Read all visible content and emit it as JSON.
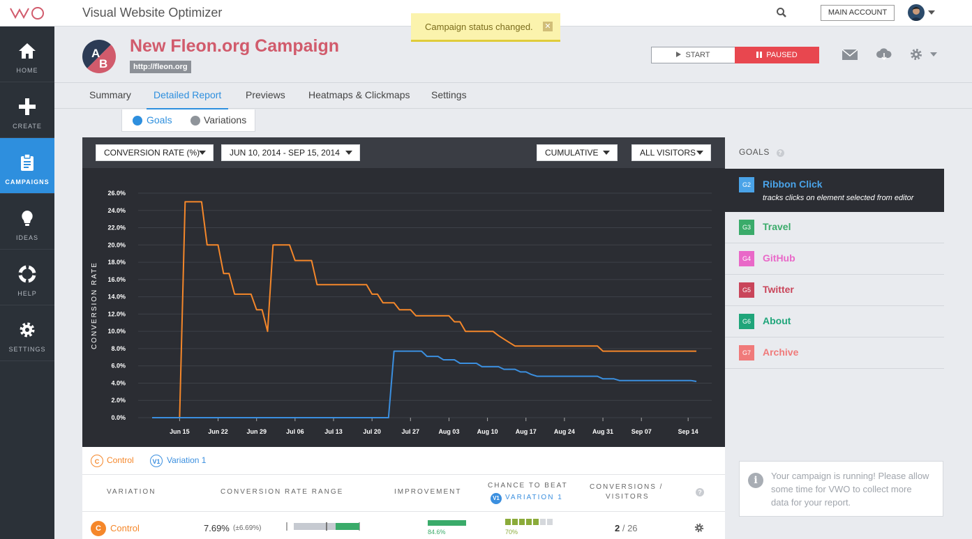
{
  "app": {
    "title": "Visual Website Optimizer",
    "logo": "VWO",
    "main_account": "MAIN ACCOUNT"
  },
  "toast": {
    "message": "Campaign status changed."
  },
  "sidebar": {
    "items": [
      {
        "label": "HOME",
        "icon": "home-icon"
      },
      {
        "label": "CREATE",
        "icon": "plus-icon"
      },
      {
        "label": "CAMPAIGNS",
        "icon": "clipboard-icon",
        "active": true
      },
      {
        "label": "IDEAS",
        "icon": "lightbulb-icon"
      },
      {
        "label": "HELP",
        "icon": "lifebuoy-icon"
      },
      {
        "label": "SETTINGS",
        "icon": "gear-icon"
      }
    ]
  },
  "campaign": {
    "badge": "AB",
    "title": "New Fleon.org Campaign",
    "url": "http://fleon.org",
    "start_label": "START",
    "paused_label": "PAUSED"
  },
  "tabs": [
    "Summary",
    "Detailed Report",
    "Previews",
    "Heatmaps & Clickmaps",
    "Settings"
  ],
  "subtabs": [
    "Goals",
    "Variations"
  ],
  "filters": {
    "metric": "CONVERSION RATE (%)",
    "date_range": "JUN 10, 2014 - SEP 15, 2014",
    "mode": "CUMULATIVE",
    "segment": "ALL VISITORS"
  },
  "chart_data": {
    "type": "line",
    "title": "",
    "xlabel": "",
    "ylabel": "CONVERSION RATE",
    "ylim": [
      0,
      26
    ],
    "yticks": [
      "0.0%",
      "2.0%",
      "4.0%",
      "6.0%",
      "8.0%",
      "10.0%",
      "12.0%",
      "14.0%",
      "16.0%",
      "18.0%",
      "20.0%",
      "22.0%",
      "24.0%",
      "26.0%"
    ],
    "xticks": [
      "Jun 15",
      "Jun 22",
      "Jun 29",
      "Jul 06",
      "Jul 13",
      "Jul 20",
      "Jul 27",
      "Aug 03",
      "Aug 10",
      "Aug 17",
      "Aug 24",
      "Aug 31",
      "Sep 07",
      "Sep 14"
    ],
    "series": [
      {
        "name": "Control",
        "color": "#f5872a",
        "points": [
          [
            0,
            0
          ],
          [
            5,
            0
          ],
          [
            6,
            25
          ],
          [
            9,
            25
          ],
          [
            10,
            20
          ],
          [
            12,
            20
          ],
          [
            13,
            16.7
          ],
          [
            14,
            16.7
          ],
          [
            15,
            14.3
          ],
          [
            18,
            14.3
          ],
          [
            19,
            12.5
          ],
          [
            20,
            12.5
          ],
          [
            21,
            10
          ],
          [
            22,
            20
          ],
          [
            25,
            20
          ],
          [
            26,
            18.2
          ],
          [
            29,
            18.2
          ],
          [
            30,
            15.4
          ],
          [
            39,
            15.4
          ],
          [
            40,
            14.3
          ],
          [
            41,
            14.3
          ],
          [
            42,
            13.3
          ],
          [
            44,
            13.3
          ],
          [
            45,
            12.5
          ],
          [
            47,
            12.5
          ],
          [
            48,
            11.8
          ],
          [
            54,
            11.8
          ],
          [
            55,
            11.1
          ],
          [
            56,
            11.1
          ],
          [
            57,
            10
          ],
          [
            62,
            10
          ],
          [
            63,
            9.5
          ],
          [
            64,
            9.1
          ],
          [
            65,
            8.7
          ],
          [
            66,
            8.3
          ],
          [
            81,
            8.3
          ],
          [
            82,
            7.7
          ],
          [
            99,
            7.7
          ]
        ]
      },
      {
        "name": "Variation 1",
        "color": "#3b8fdf",
        "points": [
          [
            0,
            0
          ],
          [
            43,
            0
          ],
          [
            44,
            7.7
          ],
          [
            49,
            7.7
          ],
          [
            50,
            7.1
          ],
          [
            52,
            7.1
          ],
          [
            53,
            6.7
          ],
          [
            55,
            6.7
          ],
          [
            56,
            6.3
          ],
          [
            59,
            6.3
          ],
          [
            60,
            5.9
          ],
          [
            63,
            5.9
          ],
          [
            64,
            5.6
          ],
          [
            66,
            5.6
          ],
          [
            67,
            5.3
          ],
          [
            68,
            5.3
          ],
          [
            69,
            5
          ],
          [
            70,
            4.8
          ],
          [
            81,
            4.8
          ],
          [
            82,
            4.5
          ],
          [
            84,
            4.5
          ],
          [
            85,
            4.3
          ],
          [
            98,
            4.3
          ],
          [
            99,
            4.2
          ]
        ]
      }
    ]
  },
  "legend": [
    {
      "badge": "C",
      "label": "Control",
      "color": "#f5872a"
    },
    {
      "badge": "V1",
      "label": "Variation 1",
      "color": "#3b8fdf"
    }
  ],
  "table": {
    "headers": {
      "variation": "VARIATION",
      "range": "CONVERSION RATE RANGE",
      "improvement": "IMPROVEMENT",
      "chance_line1": "CHANCE TO BEAT",
      "chance_badge": "V1",
      "chance_line2": "VARIATION 1",
      "conv_line1": "CONVERSIONS /",
      "conv_line2": "VISITORS"
    },
    "rows": [
      {
        "badge": "C",
        "name": "Control",
        "rate": "7.69%",
        "range": "(±6.69%)",
        "improvement": "84.6%",
        "improvement_fraction": 0.846,
        "chance": "70%",
        "chance_fraction": 0.7,
        "conversions": "2",
        "visitors": "26"
      }
    ]
  },
  "goals": {
    "title": "GOALS",
    "items": [
      {
        "id": "G2",
        "name": "Ribbon Click",
        "desc": "tracks clicks on element selected from editor",
        "color": "#4aa3e8",
        "active": true
      },
      {
        "id": "G3",
        "name": "Travel",
        "color": "#3aab6a"
      },
      {
        "id": "G4",
        "name": "GitHub",
        "color": "#e968c8"
      },
      {
        "id": "G5",
        "name": "Twitter",
        "color": "#c9455a"
      },
      {
        "id": "G6",
        "name": "About",
        "color": "#1fa57a"
      },
      {
        "id": "G7",
        "name": "Archive",
        "color": "#f07a7a"
      }
    ]
  },
  "info": {
    "message": "Your campaign is running! Please allow some time for VWO to collect more data for your report."
  }
}
